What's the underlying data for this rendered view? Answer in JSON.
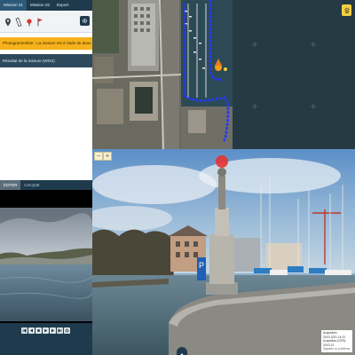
{
  "tabs": [
    {
      "label": "Mission 01",
      "active": true
    },
    {
      "label": "Mission 02",
      "active": false
    },
    {
      "label": "Export",
      "active": false
    }
  ],
  "toolbar": {
    "tools": [
      "map-pin-icon",
      "ruler-icon",
      "marker-icon",
      "flag-icon"
    ],
    "settings": "gear-icon"
  },
  "warning_text": "Photogrammétrie : La mesure est à l'aide de deux images !",
  "status_text": "Résultat de la mesure (WGS)",
  "photo_tabs": [
    {
      "label": "ÉDITER",
      "active": true
    },
    {
      "label": "CALQUE",
      "active": false
    }
  ],
  "player_controls": [
    "first-icon",
    "prev-icon",
    "stop-icon",
    "play-icon",
    "next-icon",
    "last-icon",
    "settings-icon"
  ],
  "map": {
    "layer_button": "layers-icon",
    "accent_color": "#2438ff",
    "marker_color": "#f39c12"
  },
  "street": {
    "zoom_out": "−",
    "zoom_in": "+",
    "caption_lines": [
      "Acquisition: 29.03.2021 14:23",
      "Acquisition (GPS): 29.03.21",
      "Signaler un problème"
    ],
    "target_color": "#e53232"
  }
}
